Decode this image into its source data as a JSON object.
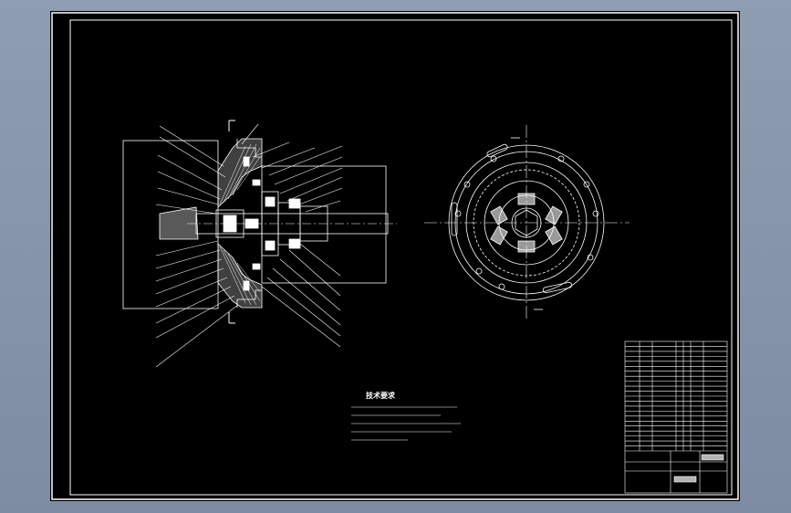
{
  "drawing": {
    "title": "",
    "view_label": "",
    "callouts_left": [
      "",
      "",
      "",
      "",
      "",
      "",
      "",
      "",
      "",
      "",
      "",
      "",
      "",
      "",
      ""
    ],
    "callouts_right": [
      "",
      "",
      "",
      "",
      "",
      "",
      "",
      "",
      "",
      "",
      "",
      "",
      "",
      "",
      "",
      ""
    ],
    "section_marks": [
      "",
      "",
      "",
      ""
    ]
  },
  "technical_requirements": {
    "heading": "技术要求",
    "items": [
      "",
      "",
      "",
      "",
      "",
      ""
    ]
  },
  "title_block": {
    "rows": 22,
    "drawing_name": "",
    "drawing_number": "",
    "company": ""
  },
  "colors": {
    "background_outer": "#8a98ad",
    "sheet": "#000000",
    "linework": "#ffffff"
  }
}
